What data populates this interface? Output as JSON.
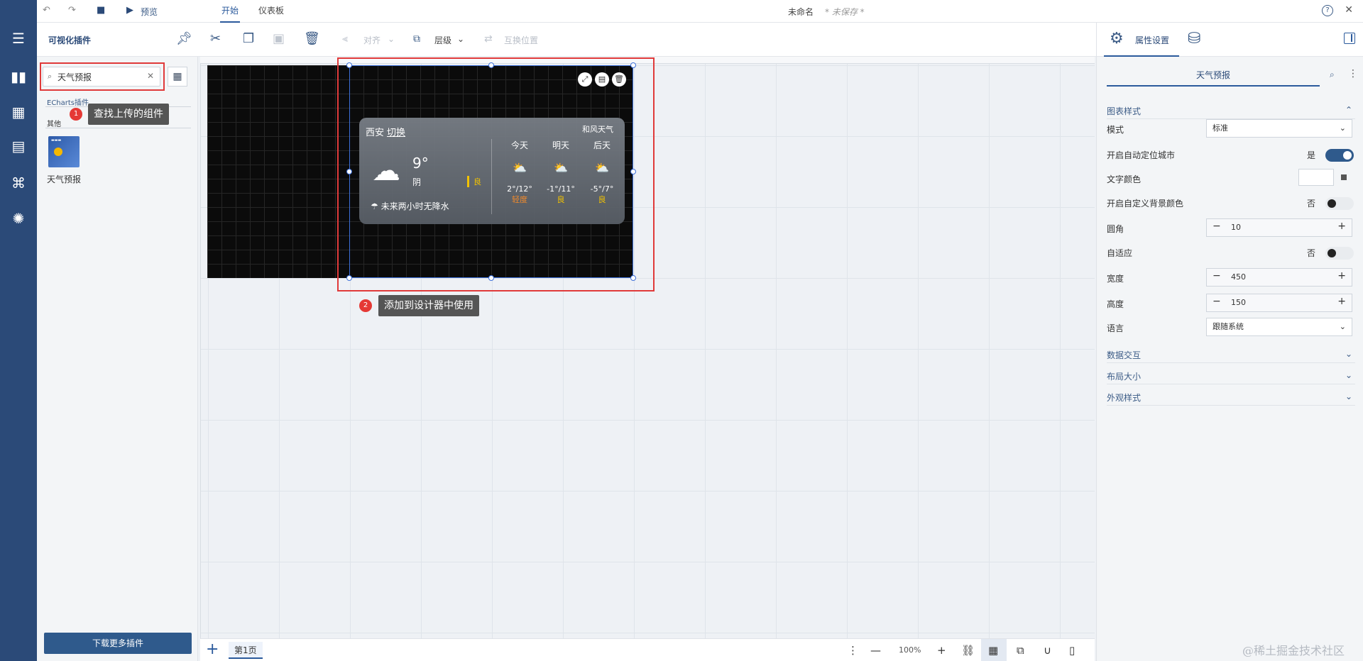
{
  "topbar": {
    "preview_label": "预览",
    "tab_start": "开始",
    "tab_dashboard": "仪表板",
    "doc_title": "未命名",
    "doc_status": "* 未保存 *",
    "help_label": "?"
  },
  "toolbar": {
    "panel_title": "可视化插件",
    "align_label": "对齐",
    "layer_label": "层级",
    "swap_label": "互换位置"
  },
  "plugins": {
    "search_value": "天气预报",
    "category_echarts": "ECharts插件",
    "category_other": "其他",
    "item_name": "天气预报",
    "download_label": "下载更多插件"
  },
  "callouts": {
    "step1_num": "1",
    "step1_text": "查找上传的组件",
    "step2_num": "2",
    "step2_text": "添加到设计器中使用"
  },
  "weather": {
    "city": "西安",
    "switch": "切换",
    "brand": "和风天气",
    "temp": "9°",
    "condition": "阴",
    "aqi": "良",
    "rain": "未来两小时无降水",
    "forecast": [
      {
        "day": "今天",
        "range": "2°/12°",
        "quality": "轻度"
      },
      {
        "day": "明天",
        "range": "-1°/11°",
        "quality": "良"
      },
      {
        "day": "后天",
        "range": "-5°/7°",
        "quality": "良"
      }
    ]
  },
  "bottombar": {
    "page_tab": "第1页",
    "zoom": "100%"
  },
  "props": {
    "tab_settings": "属性设置",
    "component_name": "天气预报",
    "sec_chart_style": "图表样式",
    "mode_label": "模式",
    "mode_value": "标准",
    "auto_locate_label": "开启自动定位城市",
    "auto_locate_value": "是",
    "text_color_label": "文字颜色",
    "custom_bg_label": "开启自定义背景颜色",
    "custom_bg_value": "否",
    "radius_label": "圆角",
    "radius_value": "10",
    "adaptive_label": "自适应",
    "adaptive_value": "否",
    "width_label": "宽度",
    "width_value": "450",
    "height_label": "高度",
    "height_value": "150",
    "language_label": "语言",
    "language_value": "跟随系统",
    "sec_data": "数据交互",
    "sec_layout": "布局大小",
    "sec_appearance": "外观样式"
  },
  "watermark": "@稀土掘金技术社区",
  "colors": {
    "nav_bg": "#2b4a78",
    "accent": "#2b5a9c",
    "highlight": "#e03a3a"
  }
}
